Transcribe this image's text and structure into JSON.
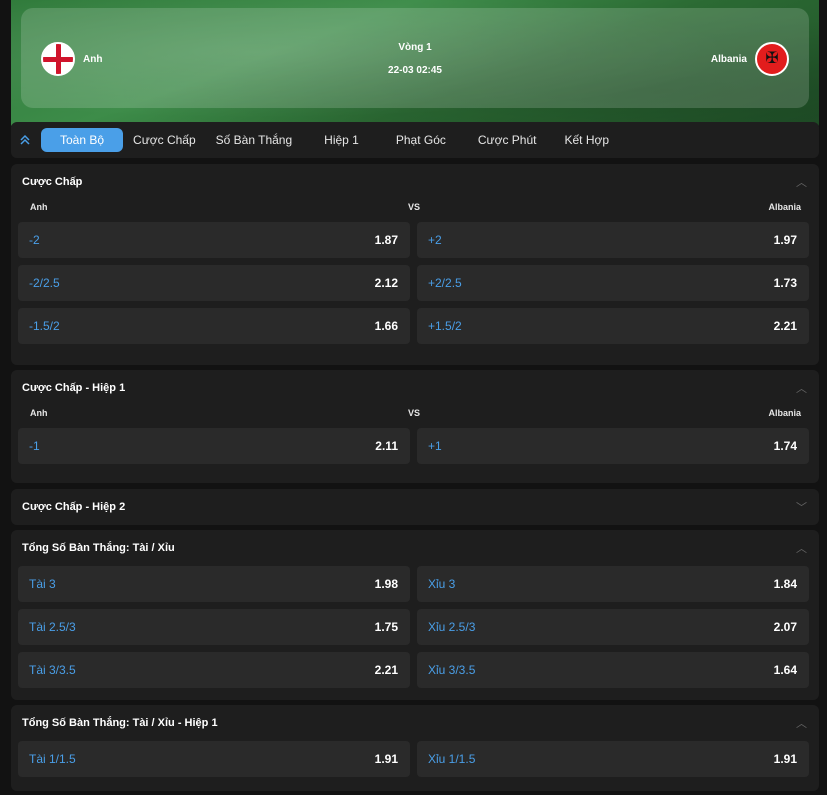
{
  "match": {
    "home": "Anh",
    "away": "Albania",
    "round": "Vòng 1",
    "datetime": "22-03 02:45"
  },
  "tabs": [
    "Toàn Bộ",
    "Cược Chấp",
    "Số Bàn Thắng",
    "Hiệp 1",
    "Phạt Góc",
    "Cược Phút",
    "Kết Hợp"
  ],
  "sections": {
    "s1": {
      "title": "Cược Chấp",
      "home_label": "Anh",
      "vs": "VS",
      "away_label": "Albania",
      "rows": [
        [
          {
            "label": "-2",
            "odd": "1.87"
          },
          {
            "label": "+2",
            "odd": "1.97"
          }
        ],
        [
          {
            "label": "-2/2.5",
            "odd": "2.12"
          },
          {
            "label": "+2/2.5",
            "odd": "1.73"
          }
        ],
        [
          {
            "label": "-1.5/2",
            "odd": "1.66"
          },
          {
            "label": "+1.5/2",
            "odd": "2.21"
          }
        ]
      ]
    },
    "s2": {
      "title": "Cược Chấp - Hiệp 1",
      "home_label": "Anh",
      "vs": "VS",
      "away_label": "Albania",
      "rows": [
        [
          {
            "label": "-1",
            "odd": "2.11"
          },
          {
            "label": "+1",
            "odd": "1.74"
          }
        ]
      ]
    },
    "s3": {
      "title": "Cược Chấp - Hiệp 2"
    },
    "s4": {
      "title": "Tổng Số Bàn Thắng: Tài / Xỉu",
      "rows": [
        [
          {
            "label": "Tài 3",
            "odd": "1.98"
          },
          {
            "label": "Xỉu 3",
            "odd": "1.84"
          }
        ],
        [
          {
            "label": "Tài 2.5/3",
            "odd": "1.75"
          },
          {
            "label": "Xỉu 2.5/3",
            "odd": "2.07"
          }
        ],
        [
          {
            "label": "Tài 3/3.5",
            "odd": "2.21"
          },
          {
            "label": "Xỉu 3/3.5",
            "odd": "1.64"
          }
        ]
      ]
    },
    "s5": {
      "title": "Tổng Số Bàn Thắng: Tài / Xỉu - Hiệp 1",
      "rows": [
        [
          {
            "label": "Tài 1/1.5",
            "odd": "1.91"
          },
          {
            "label": "Xỉu 1/1.5",
            "odd": "1.91"
          }
        ]
      ]
    }
  },
  "colors": {
    "accent": "#4a9fe8",
    "panel": "#1e1e1e",
    "cell": "#2a2a2a"
  }
}
